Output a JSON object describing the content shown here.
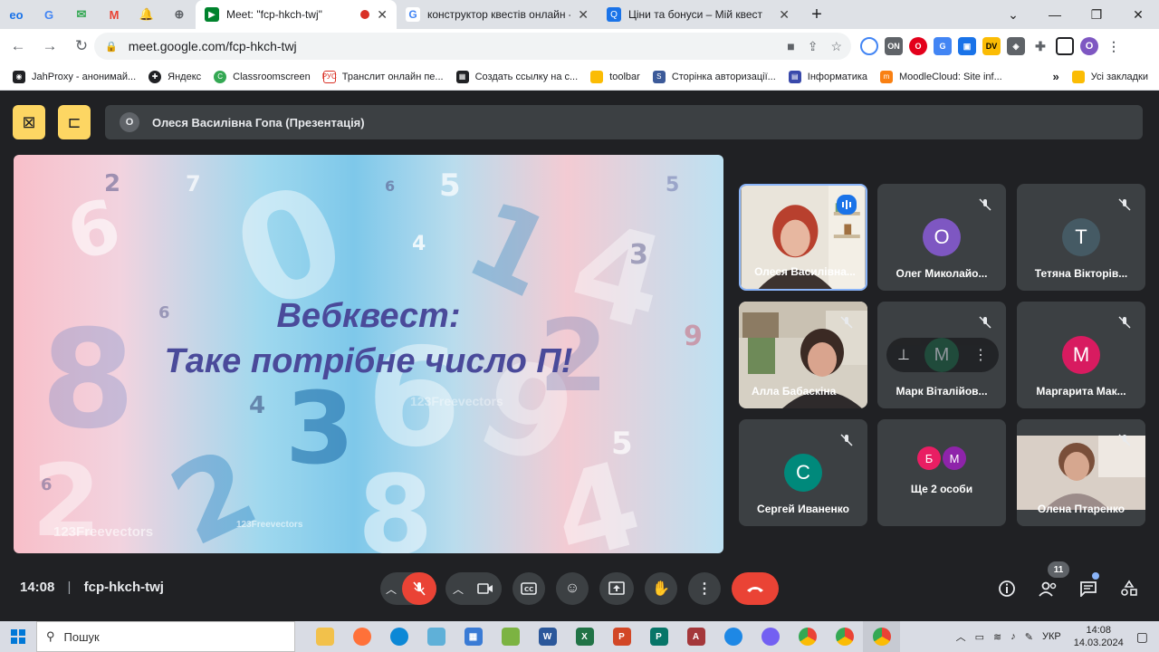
{
  "browser": {
    "pinned_tabs": [
      "eo",
      "G",
      "✉",
      "M",
      "🔔",
      "⊕"
    ],
    "tabs": [
      {
        "title": "Meet: \"fcp-hkch-twj\"",
        "active": true,
        "fav_color": "#00832d"
      },
      {
        "title": "конструктор квестів онлайн - Пош",
        "active": false,
        "fav_color": "#4285f4"
      },
      {
        "title": "Ціни та бонуси – Мій квест",
        "active": false,
        "fav_color": "#1a73e8"
      }
    ],
    "url": "meet.google.com/fcp-hkch-twj",
    "bookmarks": [
      "JahProxy - анонимай...",
      "Яндекс",
      "Classroomscreen",
      "Транслит онлайн пе...",
      "Создать ссылку на с...",
      "toolbar",
      "Сторінка авторизації...",
      "Інформатика",
      "MoodleCloud: Site inf..."
    ],
    "all_bookmarks": "Усі закладки",
    "profile_initial": "O"
  },
  "meet": {
    "presenter_initial": "О",
    "presenter_label": "Олеся Василівна Гопа (Презентація)",
    "slide": {
      "title_line1": "Вебквест:",
      "title_line2": "Таке потрібне число П!",
      "watermark1": "123Freevectors",
      "watermark2": "123Freevectors",
      "watermark3": "123Freevectors"
    },
    "participants": [
      {
        "name": "Олеся Василівна...",
        "initial": "",
        "color": "",
        "photo": true,
        "speaking": true
      },
      {
        "name": "Олег Миколайо...",
        "initial": "О",
        "color": "#7e57c2",
        "photo": false
      },
      {
        "name": "Тетяна Вікторів...",
        "initial": "Т",
        "color": "#455a64",
        "photo": false
      },
      {
        "name": "Алла Бабаскіна",
        "initial": "",
        "color": "",
        "photo": true
      },
      {
        "name": "Марк Віталійов...",
        "initial": "М",
        "color": "#1e4d3b",
        "photo": false,
        "hover": true
      },
      {
        "name": "Маргарита Мак...",
        "initial": "М",
        "color": "#d81b60",
        "photo": false
      },
      {
        "name": "Сергей Иваненко",
        "initial": "С",
        "color": "#00897b",
        "photo": false
      },
      {
        "name": "Ще 2 особи",
        "initial": "",
        "color": "",
        "photo": false,
        "more": [
          "Б",
          "М"
        ]
      },
      {
        "name": "Олена Птаренко",
        "initial": "",
        "color": "",
        "photo": true
      }
    ],
    "clock": "14:08",
    "meeting_code": "fcp-hkch-twj",
    "people_count": "11"
  },
  "taskbar": {
    "search_placeholder": "Пошук",
    "lang": "УКР",
    "time": "14:08",
    "date": "14.03.2024"
  }
}
